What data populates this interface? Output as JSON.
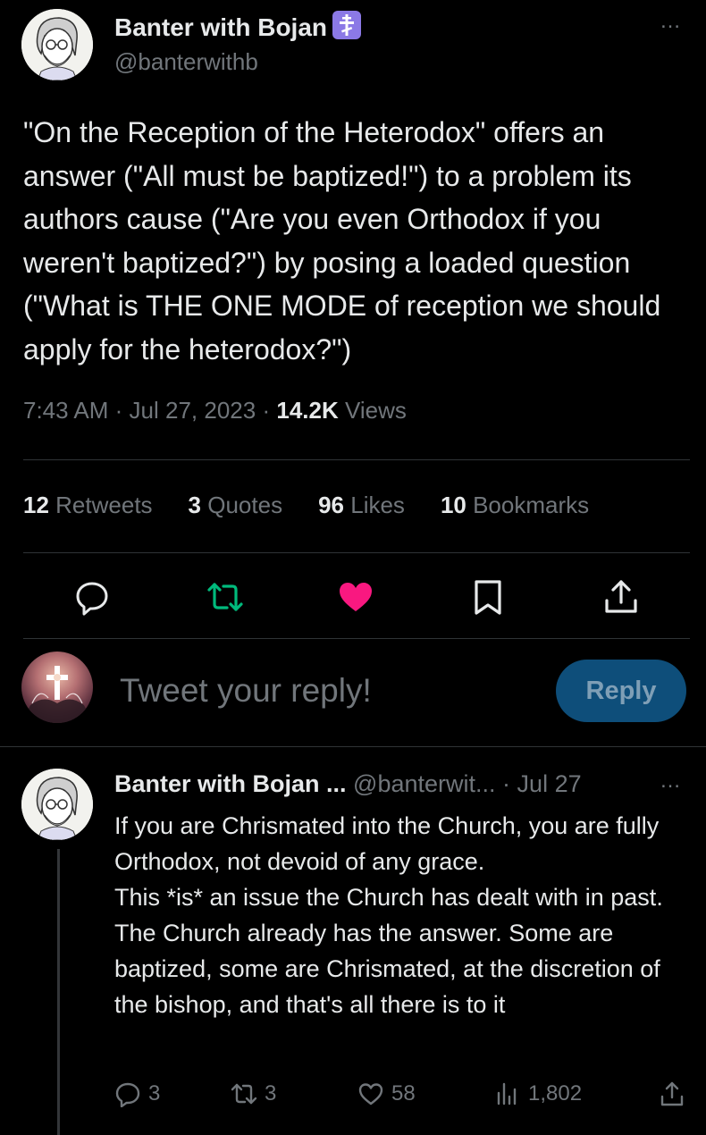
{
  "tweet": {
    "author_name": "Banter with Bojan",
    "author_handle": "@banterwithb",
    "more_icon": "…",
    "text": "\"On the Reception of the Heterodox\" offers an answer (\"All must be baptized!\") to a problem its authors cause (\"Are you even Orthodox if you weren't baptized?\") by posing a loaded question (\"What is THE ONE MODE of reception we should apply for the heterodox?\")",
    "time": "7:43 AM",
    "separator": "·",
    "date": "Jul 27, 2023",
    "views_count": "14.2K",
    "views_label": "Views"
  },
  "stats": {
    "retweets_count": "12",
    "retweets_label": "Retweets",
    "quotes_count": "3",
    "quotes_label": "Quotes",
    "likes_count": "96",
    "likes_label": "Likes",
    "bookmarks_count": "10",
    "bookmarks_label": "Bookmarks"
  },
  "actions": {
    "icons": [
      "reply-icon",
      "retweet-icon",
      "like-icon",
      "bookmark-icon",
      "share-icon"
    ],
    "retweet_color": "#00ba7c",
    "like_color": "#f91880"
  },
  "composer": {
    "placeholder": "Tweet your reply!",
    "reply_button": "Reply",
    "button_color": "#0e4e7a"
  },
  "reply": {
    "author_name": "Banter with Bojan ...",
    "author_handle": "@banterwit...",
    "separator": "·",
    "date": "Jul 27",
    "more_icon": "…",
    "text_line1": "If you are Chrismated into the Church, you are fully Orthodox, not devoid of any grace.",
    "text_line2": "This *is* an issue the Church has dealt with in past. The Church already has the answer. Some are baptized, some are Chrismated, at the discretion of the bishop, and that's all there is to it",
    "reply_count": "3",
    "retweet_count": "3",
    "like_count": "58",
    "views_count": "1,802"
  },
  "colors": {
    "background": "#000000",
    "text": "#e7e9ea",
    "muted": "#71767b",
    "badge": "#8b79e6"
  }
}
